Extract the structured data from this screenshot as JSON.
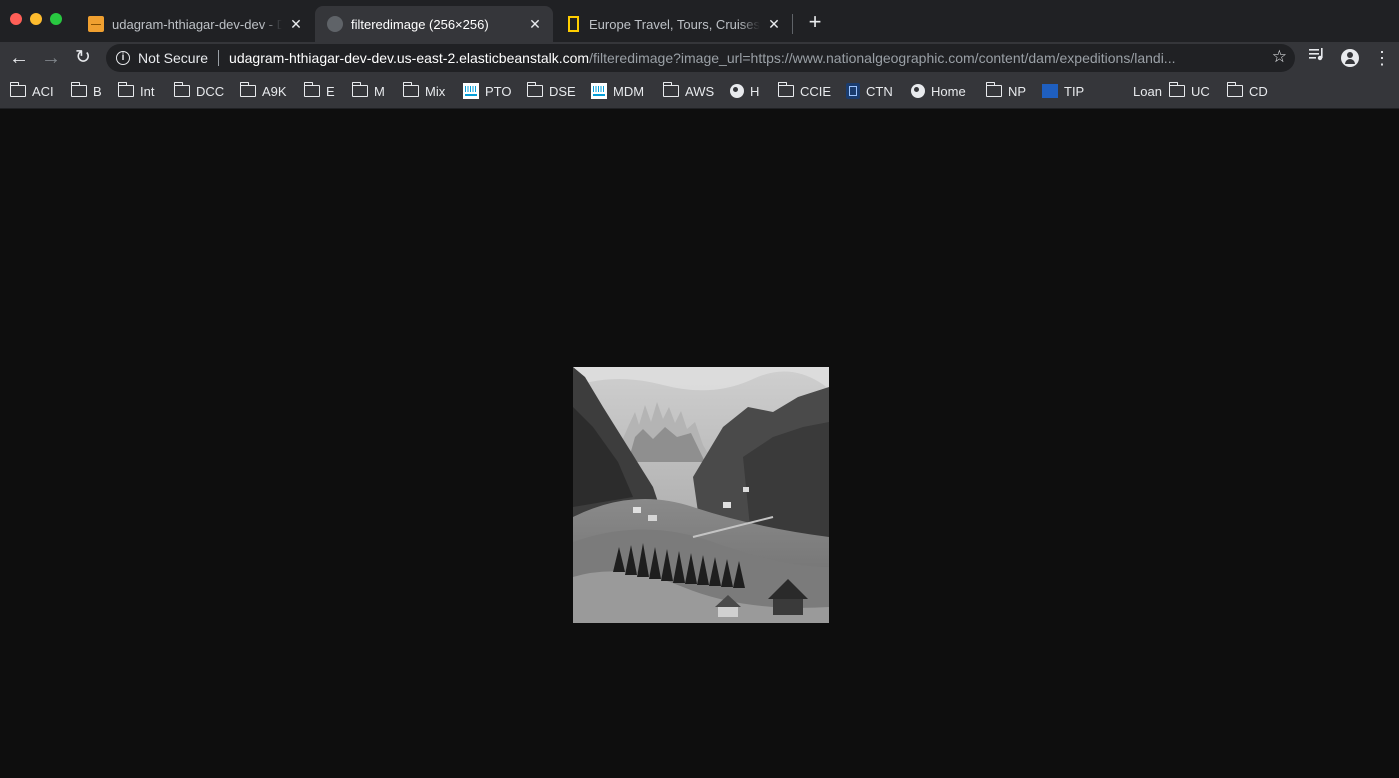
{
  "window": {
    "controls": [
      "close",
      "minimize",
      "zoom"
    ]
  },
  "tabs": [
    {
      "title": "udagram-hthiagar-dev-dev - D",
      "icon": "aws-elastic-beanstalk-icon",
      "active": false
    },
    {
      "title": "filteredimage (256×256)",
      "icon": "globe-icon",
      "active": true
    },
    {
      "title": "Europe Travel, Tours, Cruises &",
      "icon": "national-geographic-icon",
      "active": false
    }
  ],
  "toolbar": {
    "security_label": "Not Secure",
    "url_host": "udagram-hthiagar-dev-dev.us-east-2.elasticbeanstalk.com",
    "url_rest": "/filteredimage?image_url=https://www.nationalgeographic.com/content/dam/expeditions/landi..."
  },
  "bookmarks": [
    {
      "label": "ACI",
      "icon": "folder-icon"
    },
    {
      "label": "B",
      "icon": "folder-icon"
    },
    {
      "label": "Int",
      "icon": "folder-icon"
    },
    {
      "label": "DCC",
      "icon": "folder-icon"
    },
    {
      "label": "A9K",
      "icon": "folder-icon"
    },
    {
      "label": "E",
      "icon": "folder-icon"
    },
    {
      "label": "M",
      "icon": "folder-icon"
    },
    {
      "label": "Mix",
      "icon": "folder-icon"
    },
    {
      "label": "PTO",
      "icon": "cisco-icon"
    },
    {
      "label": "DSE",
      "icon": "folder-icon"
    },
    {
      "label": "MDM",
      "icon": "cisco-icon"
    },
    {
      "label": "AWS",
      "icon": "folder-icon"
    },
    {
      "label": "H",
      "icon": "globe-icon"
    },
    {
      "label": "CCIE",
      "icon": "folder-icon"
    },
    {
      "label": "CTN",
      "icon": "ctn-icon"
    },
    {
      "label": "Home",
      "icon": "globe-icon"
    },
    {
      "label": "NP",
      "icon": "folder-icon"
    },
    {
      "label": "TIP",
      "icon": "tip-icon"
    },
    {
      "label": "Loan",
      "icon": "none"
    },
    {
      "label": "UC",
      "icon": "folder-icon"
    },
    {
      "label": "CD",
      "icon": "folder-icon"
    }
  ],
  "content": {
    "image_description": "grayscale mountain valley with village",
    "filter": "grayscale"
  }
}
